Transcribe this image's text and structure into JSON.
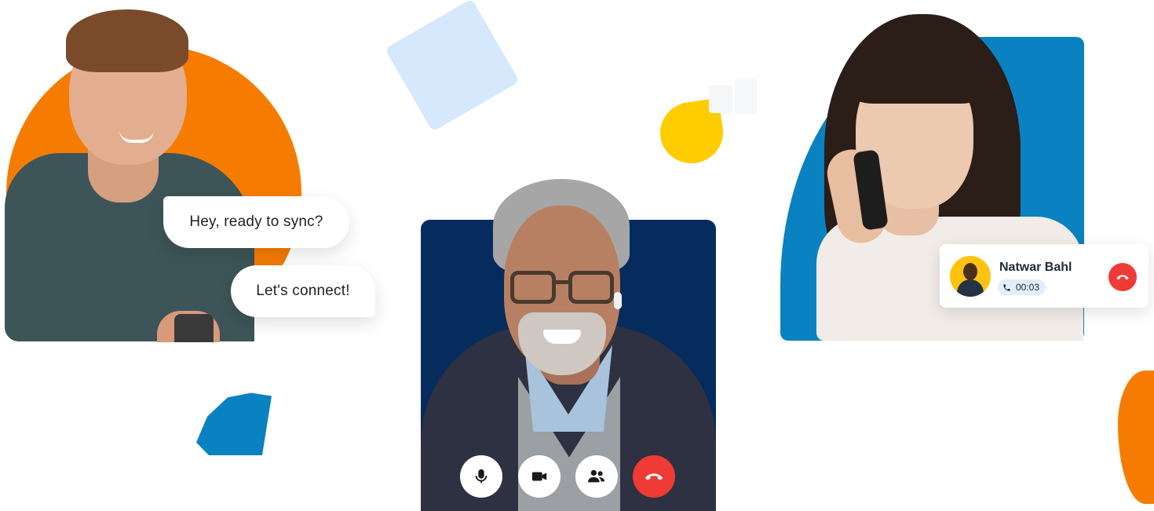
{
  "chat": {
    "bubble_1": "Hey, ready to sync?",
    "bubble_2": "Let's connect!"
  },
  "video_call": {
    "controls": [
      {
        "icon": "microphone-icon"
      },
      {
        "icon": "video-camera-icon"
      },
      {
        "icon": "participants-icon"
      },
      {
        "icon": "end-call-icon",
        "color": "#ef3a35"
      }
    ]
  },
  "incoming_call": {
    "caller_name": "Natwar Bahl",
    "duration": "00:03",
    "end_color": "#ef3a35"
  },
  "colors": {
    "orange": "#f57c00",
    "blue": "#0a82c1",
    "navy": "#062c5e",
    "yellow": "#ffcc00",
    "light_blue": "#d6e8fb",
    "red": "#ef3a35"
  }
}
